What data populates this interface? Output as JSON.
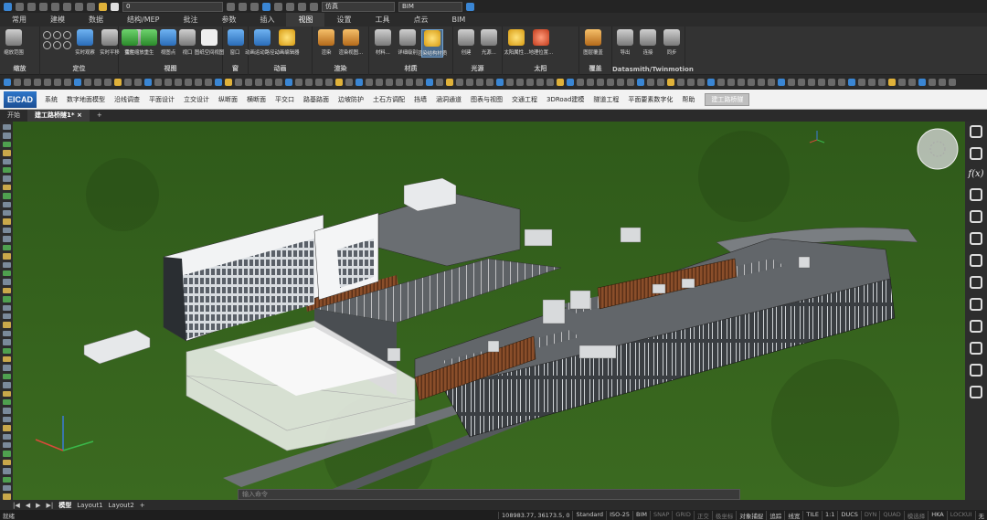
{
  "qat": {
    "layer_value": "0",
    "visual_style": "仿真",
    "workspace": "BIM"
  },
  "menu_tabs": [
    "常用",
    "建模",
    "数据",
    "结构/MEP",
    "批注",
    "参数",
    "插入",
    "视图",
    "设置",
    "工具",
    "点云",
    "BIM"
  ],
  "active_tab": "视图",
  "ribbon": {
    "groups": [
      {
        "label": "缩放",
        "buttons": [
          {
            "label": "缩放范围",
            "icon": "zoom-extents-icon",
            "color": "gray"
          }
        ]
      },
      {
        "label": "定位",
        "buttons": [
          {
            "label": "实时观察",
            "icon": "orbit-icon",
            "color": "blue"
          },
          {
            "label": "实时平移",
            "icon": "pan-hand-icon",
            "color": "gray"
          },
          {
            "label": "实时缩放",
            "icon": "zoom-realtime-icon",
            "color": "gray"
          }
        ]
      },
      {
        "label": "视图",
        "buttons": [
          {
            "label": "重生",
            "icon": "regen-icon",
            "color": "green"
          },
          {
            "label": "重生",
            "icon": "regen-all-icon",
            "color": "green"
          },
          {
            "label": "视图点",
            "icon": "eye-icon",
            "color": "blue"
          },
          {
            "label": "视口",
            "icon": "viewport-icon",
            "color": "gray"
          },
          {
            "label": "图纸空间视图",
            "icon": "paper-space-icon",
            "color": "white"
          }
        ]
      },
      {
        "label": "窗",
        "buttons": [
          {
            "label": "窗口",
            "icon": "window-icon",
            "color": "blue"
          }
        ]
      },
      {
        "label": "动画",
        "buttons": [
          {
            "label": "动画运动路径...",
            "icon": "motion-path-icon",
            "color": "blue"
          },
          {
            "label": "动画编辑器",
            "icon": "play-icon",
            "color": "yel"
          }
        ]
      },
      {
        "label": "渲染",
        "buttons": [
          {
            "label": "渲染",
            "icon": "render-teapot-icon",
            "color": "orn"
          },
          {
            "label": "渲染视图...",
            "icon": "render-view-icon",
            "color": "orn"
          }
        ]
      },
      {
        "label": "材质",
        "buttons": [
          {
            "label": "材料...",
            "icon": "material-icon",
            "color": "gray"
          },
          {
            "label": "详细级别",
            "icon": "detail-level-icon",
            "color": "gray"
          },
          {
            "label": "渲染结构材质",
            "icon": "structure-material-icon",
            "color": "yel",
            "selected": true
          }
        ]
      },
      {
        "label": "光源",
        "buttons": [
          {
            "label": "创建",
            "icon": "create-light-icon",
            "color": "gray"
          },
          {
            "label": "光源...",
            "icon": "light-icon",
            "color": "gray"
          }
        ]
      },
      {
        "label": "太阳",
        "buttons": [
          {
            "label": "太阳属性...",
            "icon": "sun-icon",
            "color": "yel"
          },
          {
            "label": "地理位置...",
            "icon": "geo-location-icon",
            "color": "red"
          }
        ]
      },
      {
        "label": "覆盖",
        "buttons": [
          {
            "label": "图层覆盖",
            "icon": "layer-override-icon",
            "color": "orn"
          }
        ]
      },
      {
        "label": "Datasmith/Twinmotion",
        "buttons": [
          {
            "label": "导出",
            "icon": "export-icon",
            "color": "gray"
          },
          {
            "label": "连接",
            "icon": "link-icon",
            "color": "gray"
          },
          {
            "label": "同步",
            "icon": "sync-icon",
            "color": "gray"
          }
        ]
      }
    ]
  },
  "eicad": {
    "logo": "EICAD",
    "menus": [
      "系统",
      "数字地面模型",
      "沿线调查",
      "平面设计",
      "立交设计",
      "纵断面",
      "横断面",
      "平交口",
      "路基路面",
      "边坡防护",
      "土石方调配",
      "挡墙",
      "涵洞通道",
      "图表与视图",
      "交通工程",
      "3DRoad建模",
      "隧道工程",
      "平面要素数字化",
      "帮助"
    ],
    "button": "建工路桥隧"
  },
  "doc_tabs": {
    "items": [
      "开始",
      "建工路桥隧1*"
    ],
    "active": "建工路桥隧1*",
    "close": "×",
    "add": "+"
  },
  "command_placeholder": "输入命令",
  "layout_tabs": {
    "items": [
      "模型",
      "Layout1",
      "Layout2"
    ],
    "active": "模型",
    "add": "+"
  },
  "status": {
    "ready": "就绪",
    "coords": "108983.77, 36173.5, 0",
    "items": [
      {
        "t": "Standard",
        "on": true
      },
      {
        "t": "ISO-25",
        "on": true
      },
      {
        "t": "BIM",
        "on": true
      },
      {
        "t": "SNAP",
        "on": false
      },
      {
        "t": "GRID",
        "on": false
      },
      {
        "t": "正交",
        "on": false
      },
      {
        "t": "极坐标",
        "on": false
      },
      {
        "t": "对象捕捉",
        "on": true
      },
      {
        "t": "追踪",
        "on": true
      },
      {
        "t": "线宽",
        "on": true
      },
      {
        "t": "TILE",
        "on": true
      },
      {
        "t": "1:1",
        "on": true
      },
      {
        "t": "DUCS",
        "on": true
      },
      {
        "t": "DYN",
        "on": false
      },
      {
        "t": "QUAD",
        "on": false
      },
      {
        "t": "模选择",
        "on": false
      },
      {
        "t": "HKA",
        "on": true
      },
      {
        "t": "LOCKUI",
        "on": false
      },
      {
        "t": "无",
        "on": true
      }
    ]
  },
  "right_panel_icons": [
    "eye-off-icon",
    "home-icon",
    "fx-icon",
    "sliders-icon",
    "location-pin-icon",
    "ruler-icon",
    "i-beam-icon",
    "layers-icon",
    "cube-icon",
    "grid-table-icon",
    "folder-icon",
    "document-icon",
    "pin-icon"
  ],
  "right_fx_label": "f(x)",
  "colors": {
    "grass": "#2f5a1a",
    "roof": "#5a5e62",
    "facade": "#e8eaec",
    "timber": "#8a4e2a",
    "accent": "#3a86d4"
  }
}
